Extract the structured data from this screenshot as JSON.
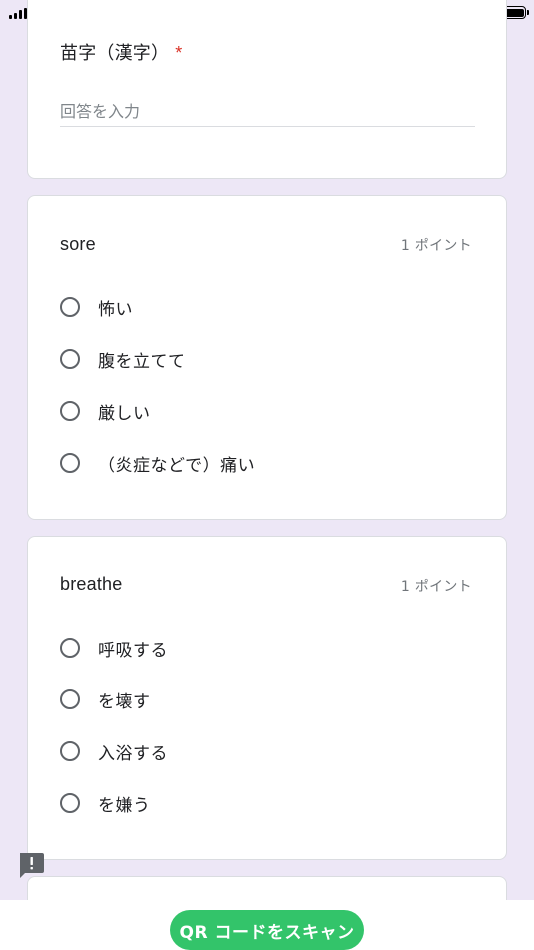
{
  "form": {
    "name_question": {
      "title": "苗字（漢字）",
      "required_mark": "*",
      "placeholder": "回答を入力"
    },
    "questions": [
      {
        "title": "sore",
        "points": "1 ポイント",
        "options": [
          "怖い",
          "腹を立てて",
          "厳しい",
          "（炎症などで）痛い"
        ]
      },
      {
        "title": "breathe",
        "points": "1 ポイント",
        "options": [
          "呼吸する",
          "を壊す",
          "入浴する",
          "を嫌う"
        ]
      }
    ]
  },
  "bottom_bar": {
    "scan_button_label": "QR コードをスキャン"
  },
  "colors": {
    "background": "#ede7f6",
    "required": "#d93025",
    "scan_button": "#33c46a"
  },
  "icons": [
    "signal-icon",
    "battery-icon",
    "feedback-icon"
  ]
}
